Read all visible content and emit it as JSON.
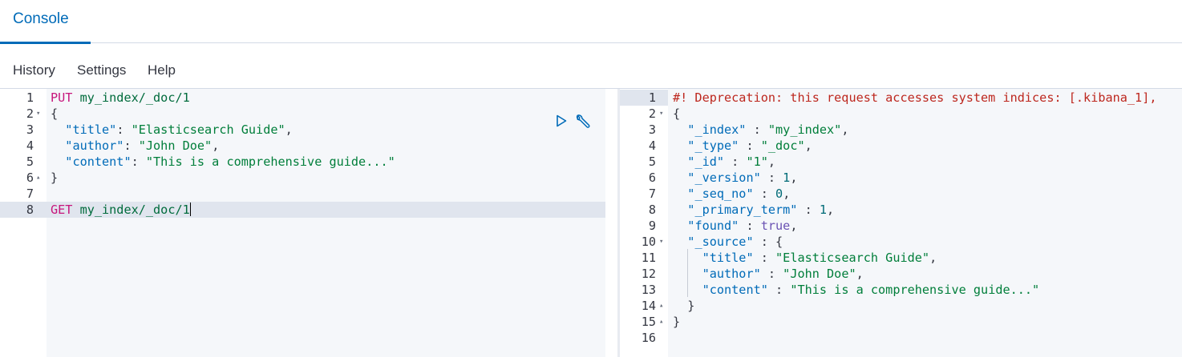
{
  "header": {
    "tab_label": "Console"
  },
  "menu": {
    "items": [
      "History",
      "Settings",
      "Help"
    ]
  },
  "request_editor": {
    "lines": [
      {
        "num": "1",
        "fold": "",
        "tokens": [
          [
            "m",
            "PUT"
          ],
          [
            "p",
            " "
          ],
          [
            "u",
            "my_index/_doc/1"
          ]
        ]
      },
      {
        "num": "2",
        "fold": "▾",
        "tokens": [
          [
            "p",
            "{"
          ]
        ]
      },
      {
        "num": "3",
        "fold": "",
        "tokens": [
          [
            "p",
            "  "
          ],
          [
            "k",
            "\"title\""
          ],
          [
            "p",
            ": "
          ],
          [
            "s",
            "\"Elasticsearch Guide\""
          ],
          [
            "p",
            ","
          ]
        ]
      },
      {
        "num": "4",
        "fold": "",
        "tokens": [
          [
            "p",
            "  "
          ],
          [
            "k",
            "\"author\""
          ],
          [
            "p",
            ": "
          ],
          [
            "s",
            "\"John Doe\""
          ],
          [
            "p",
            ","
          ]
        ]
      },
      {
        "num": "5",
        "fold": "",
        "tokens": [
          [
            "p",
            "  "
          ],
          [
            "k",
            "\"content\""
          ],
          [
            "p",
            ": "
          ],
          [
            "s",
            "\"This is a comprehensive guide...\""
          ]
        ]
      },
      {
        "num": "6",
        "fold": "▴",
        "tokens": [
          [
            "p",
            "}"
          ]
        ]
      },
      {
        "num": "7",
        "fold": "",
        "tokens": []
      },
      {
        "num": "8",
        "fold": "",
        "tokens": [
          [
            "m",
            "GET"
          ],
          [
            "p",
            " "
          ],
          [
            "u",
            "my_index/_doc/1"
          ]
        ],
        "active": true
      }
    ]
  },
  "response_editor": {
    "lines": [
      {
        "num": "1",
        "fold": "",
        "tokens": [
          [
            "w",
            "#! Deprecation: this request accesses system indices: [.kibana_1],"
          ]
        ],
        "active": true
      },
      {
        "num": "2",
        "fold": "▾",
        "tokens": [
          [
            "p",
            "{"
          ]
        ]
      },
      {
        "num": "3",
        "fold": "",
        "tokens": [
          [
            "p",
            "  "
          ],
          [
            "k",
            "\"_index\""
          ],
          [
            "p",
            " : "
          ],
          [
            "s",
            "\"my_index\""
          ],
          [
            "p",
            ","
          ]
        ]
      },
      {
        "num": "4",
        "fold": "",
        "tokens": [
          [
            "p",
            "  "
          ],
          [
            "k",
            "\"_type\""
          ],
          [
            "p",
            " : "
          ],
          [
            "s",
            "\"_doc\""
          ],
          [
            "p",
            ","
          ]
        ]
      },
      {
        "num": "5",
        "fold": "",
        "tokens": [
          [
            "p",
            "  "
          ],
          [
            "k",
            "\"_id\""
          ],
          [
            "p",
            " : "
          ],
          [
            "s",
            "\"1\""
          ],
          [
            "p",
            ","
          ]
        ]
      },
      {
        "num": "6",
        "fold": "",
        "tokens": [
          [
            "p",
            "  "
          ],
          [
            "k",
            "\"_version\""
          ],
          [
            "p",
            " : "
          ],
          [
            "n",
            "1"
          ],
          [
            "p",
            ","
          ]
        ]
      },
      {
        "num": "7",
        "fold": "",
        "tokens": [
          [
            "p",
            "  "
          ],
          [
            "k",
            "\"_seq_no\""
          ],
          [
            "p",
            " : "
          ],
          [
            "n",
            "0"
          ],
          [
            "p",
            ","
          ]
        ]
      },
      {
        "num": "8",
        "fold": "",
        "tokens": [
          [
            "p",
            "  "
          ],
          [
            "k",
            "\"_primary_term\""
          ],
          [
            "p",
            " : "
          ],
          [
            "n",
            "1"
          ],
          [
            "p",
            ","
          ]
        ]
      },
      {
        "num": "9",
        "fold": "",
        "tokens": [
          [
            "p",
            "  "
          ],
          [
            "k",
            "\"found\""
          ],
          [
            "p",
            " : "
          ],
          [
            "b",
            "true"
          ],
          [
            "p",
            ","
          ]
        ]
      },
      {
        "num": "10",
        "fold": "▾",
        "tokens": [
          [
            "p",
            "  "
          ],
          [
            "k",
            "\"_source\""
          ],
          [
            "p",
            " : {"
          ]
        ]
      },
      {
        "num": "11",
        "fold": "",
        "tokens": [
          [
            "p",
            "    "
          ],
          [
            "k",
            "\"title\""
          ],
          [
            "p",
            " : "
          ],
          [
            "s",
            "\"Elasticsearch Guide\""
          ],
          [
            "p",
            ","
          ]
        ]
      },
      {
        "num": "12",
        "fold": "",
        "tokens": [
          [
            "p",
            "    "
          ],
          [
            "k",
            "\"author\""
          ],
          [
            "p",
            " : "
          ],
          [
            "s",
            "\"John Doe\""
          ],
          [
            "p",
            ","
          ]
        ]
      },
      {
        "num": "13",
        "fold": "",
        "tokens": [
          [
            "p",
            "    "
          ],
          [
            "k",
            "\"content\""
          ],
          [
            "p",
            " : "
          ],
          [
            "s",
            "\"This is a comprehensive guide...\""
          ]
        ]
      },
      {
        "num": "14",
        "fold": "▴",
        "tokens": [
          [
            "p",
            "  }"
          ]
        ]
      },
      {
        "num": "15",
        "fold": "▴",
        "tokens": [
          [
            "p",
            "}"
          ]
        ]
      },
      {
        "num": "16",
        "fold": "",
        "tokens": []
      }
    ]
  },
  "icons": {
    "run": "play-icon",
    "settings": "wrench-icon"
  },
  "colors": {
    "accent": "#006bb8",
    "method": "#c7167c",
    "string": "#007e3a",
    "warning": "#bd271e"
  }
}
